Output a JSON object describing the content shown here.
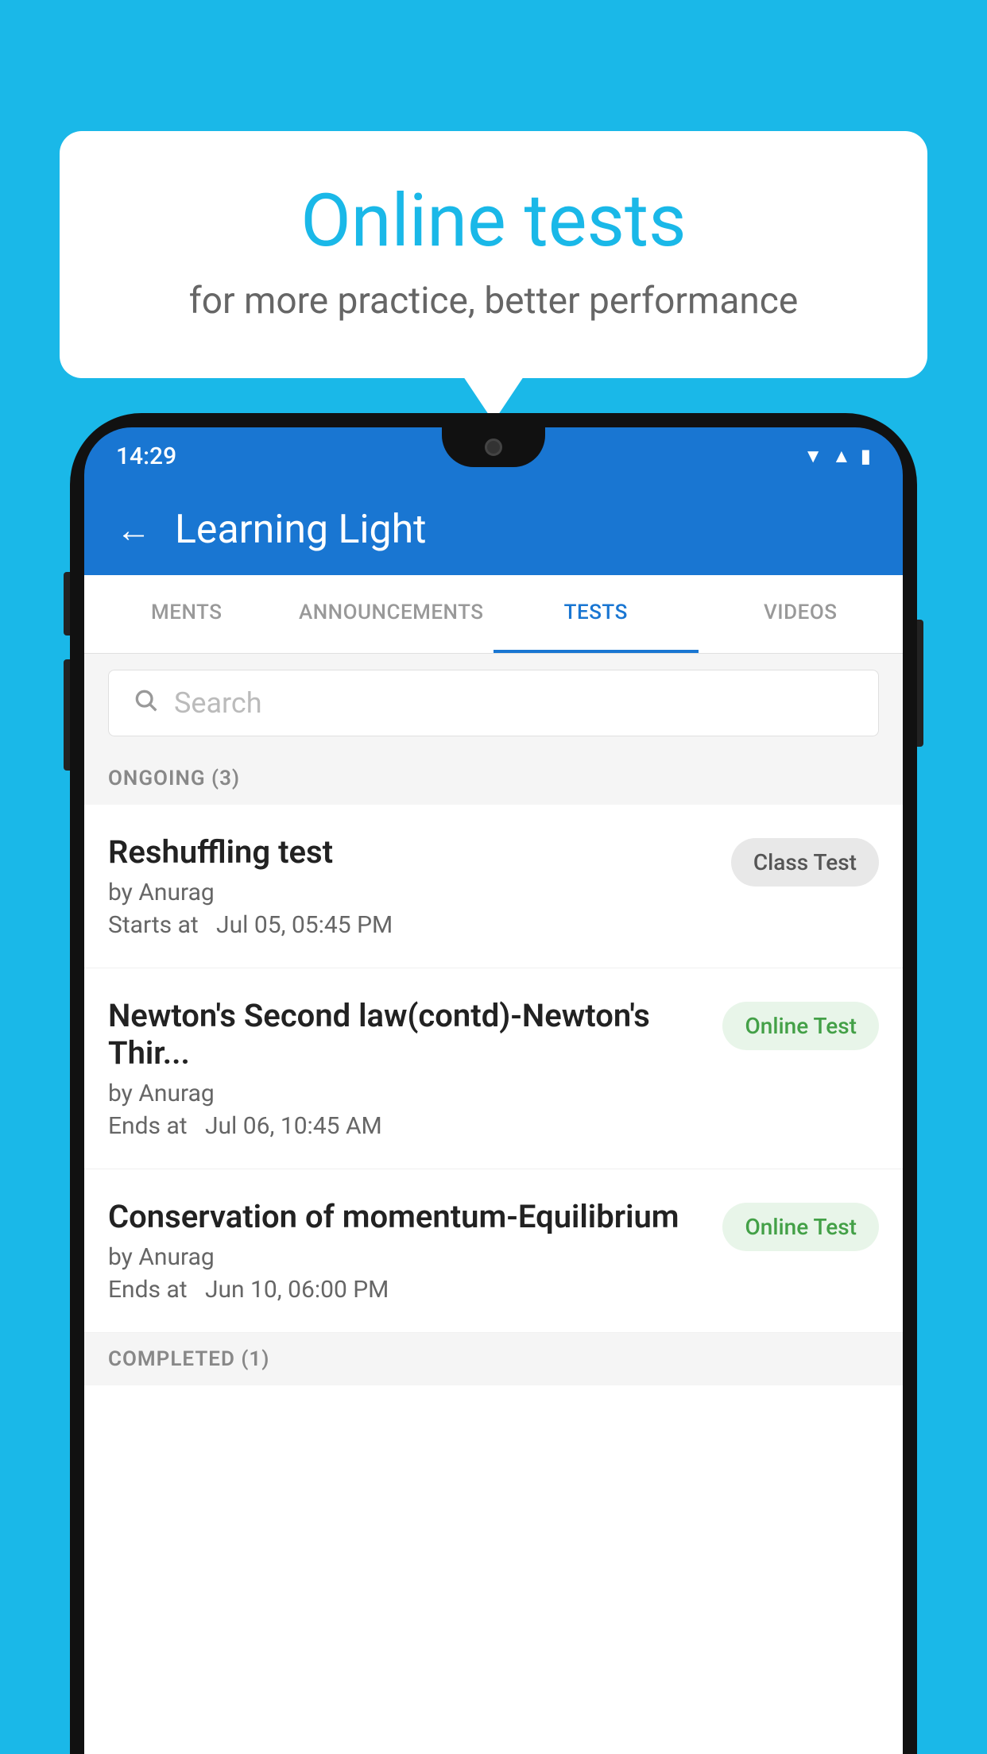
{
  "background_color": "#1ab8e8",
  "speech_bubble": {
    "title": "Online tests",
    "subtitle": "for more practice, better performance"
  },
  "phone": {
    "time": "14:29",
    "app_name": "Learning Light",
    "back_label": "←",
    "tabs": [
      {
        "label": "MENTS",
        "active": false
      },
      {
        "label": "ANNOUNCEMENTS",
        "active": false
      },
      {
        "label": "TESTS",
        "active": true
      },
      {
        "label": "VIDEOS",
        "active": false
      }
    ],
    "search_placeholder": "Search",
    "sections": [
      {
        "header": "ONGOING (3)",
        "items": [
          {
            "name": "Reshuffling test",
            "by": "by Anurag",
            "time_label": "Starts at",
            "time": "Jul 05, 05:45 PM",
            "badge": "Class Test",
            "badge_type": "class"
          },
          {
            "name": "Newton's Second law(contd)-Newton's Thir...",
            "by": "by Anurag",
            "time_label": "Ends at",
            "time": "Jul 06, 10:45 AM",
            "badge": "Online Test",
            "badge_type": "online"
          },
          {
            "name": "Conservation of momentum-Equilibrium",
            "by": "by Anurag",
            "time_label": "Ends at",
            "time": "Jun 10, 06:00 PM",
            "badge": "Online Test",
            "badge_type": "online"
          }
        ]
      }
    ],
    "completed_section": "COMPLETED (1)"
  }
}
